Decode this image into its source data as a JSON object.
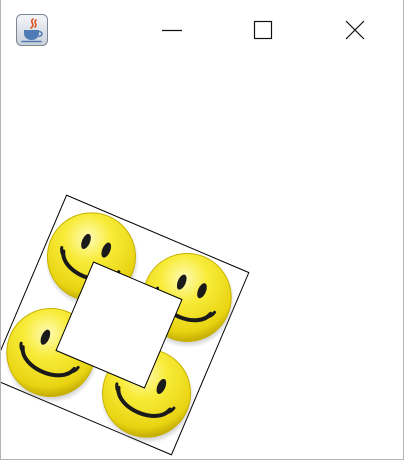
{
  "window": {
    "title": "",
    "app_icon": "java-cup-icon",
    "controls": {
      "minimize_icon": "minimize-icon",
      "maximize_icon": "maximize-icon",
      "close_icon": "close-icon"
    }
  },
  "canvas": {
    "tile_image": "smiley-face-icon",
    "tile_count": 4,
    "colors": {
      "face_yellow": "#f2e21a",
      "face_highlight": "#fff9a8",
      "face_edge": "#c9b400",
      "feature": "#1a1a1a",
      "frame_stroke": "#000000",
      "center_square": "#ffffff"
    }
  }
}
